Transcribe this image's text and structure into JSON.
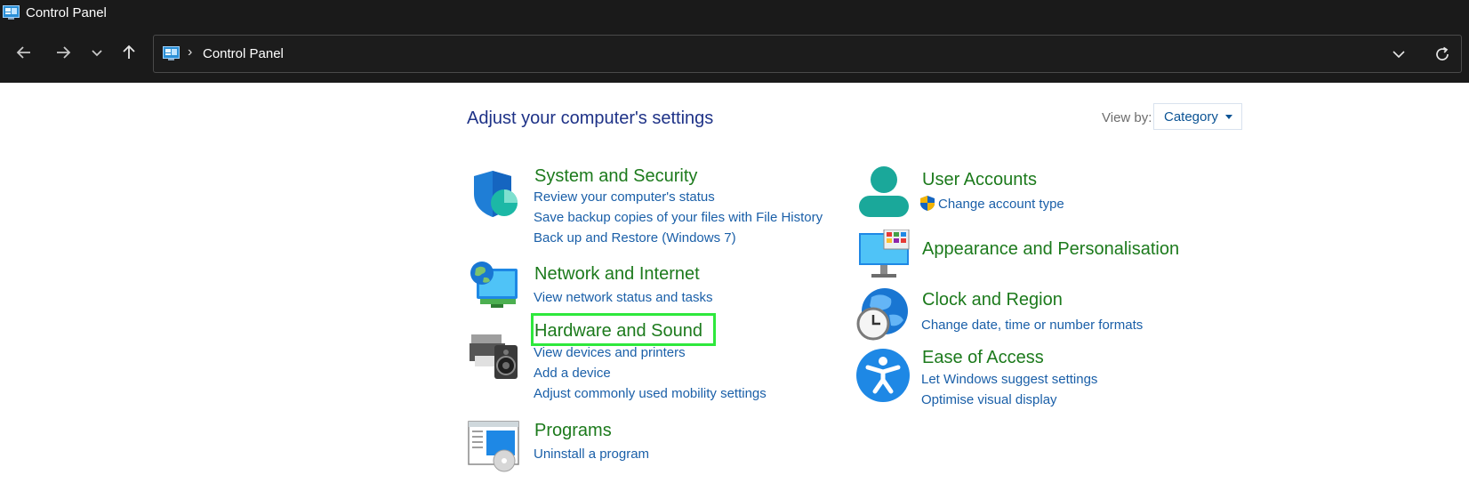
{
  "window": {
    "title": "Control Panel"
  },
  "nav": {
    "back_icon": "arrow-left-icon",
    "forward_icon": "arrow-right-icon",
    "recent_icon": "chevron-down-icon",
    "up_icon": "arrow-up-icon",
    "breadcrumb": "Control Panel",
    "dropdown_icon": "chevron-down-icon",
    "refresh_icon": "refresh-icon"
  },
  "page": {
    "heading": "Adjust your computer's settings",
    "view_by_label": "View by:",
    "view_by_value": "Category"
  },
  "categories": {
    "system_security": {
      "title": "System and Security",
      "links": [
        "Review your computer's status",
        "Save backup copies of your files with File History",
        "Back up and Restore (Windows 7)"
      ]
    },
    "network": {
      "title": "Network and Internet",
      "links": [
        "View network status and tasks"
      ]
    },
    "hardware": {
      "title": "Hardware and Sound",
      "links": [
        "View devices and printers",
        "Add a device",
        "Adjust commonly used mobility settings"
      ]
    },
    "programs": {
      "title": "Programs",
      "links": [
        "Uninstall a program"
      ]
    },
    "user_accounts": {
      "title": "User Accounts",
      "links": [
        "Change account type"
      ]
    },
    "appearance": {
      "title": "Appearance and Personalisation",
      "links": []
    },
    "clock": {
      "title": "Clock and Region",
      "links": [
        "Change date, time or number formats"
      ]
    },
    "ease": {
      "title": "Ease of Access",
      "links": [
        "Let Windows suggest settings",
        "Optimise visual display"
      ]
    }
  },
  "colors": {
    "titlebar_bg": "#1a1a1a",
    "heading": "#1e3287",
    "category_title": "#1c7a1c",
    "link": "#1a5fa8",
    "highlight": "#2ee83c"
  }
}
